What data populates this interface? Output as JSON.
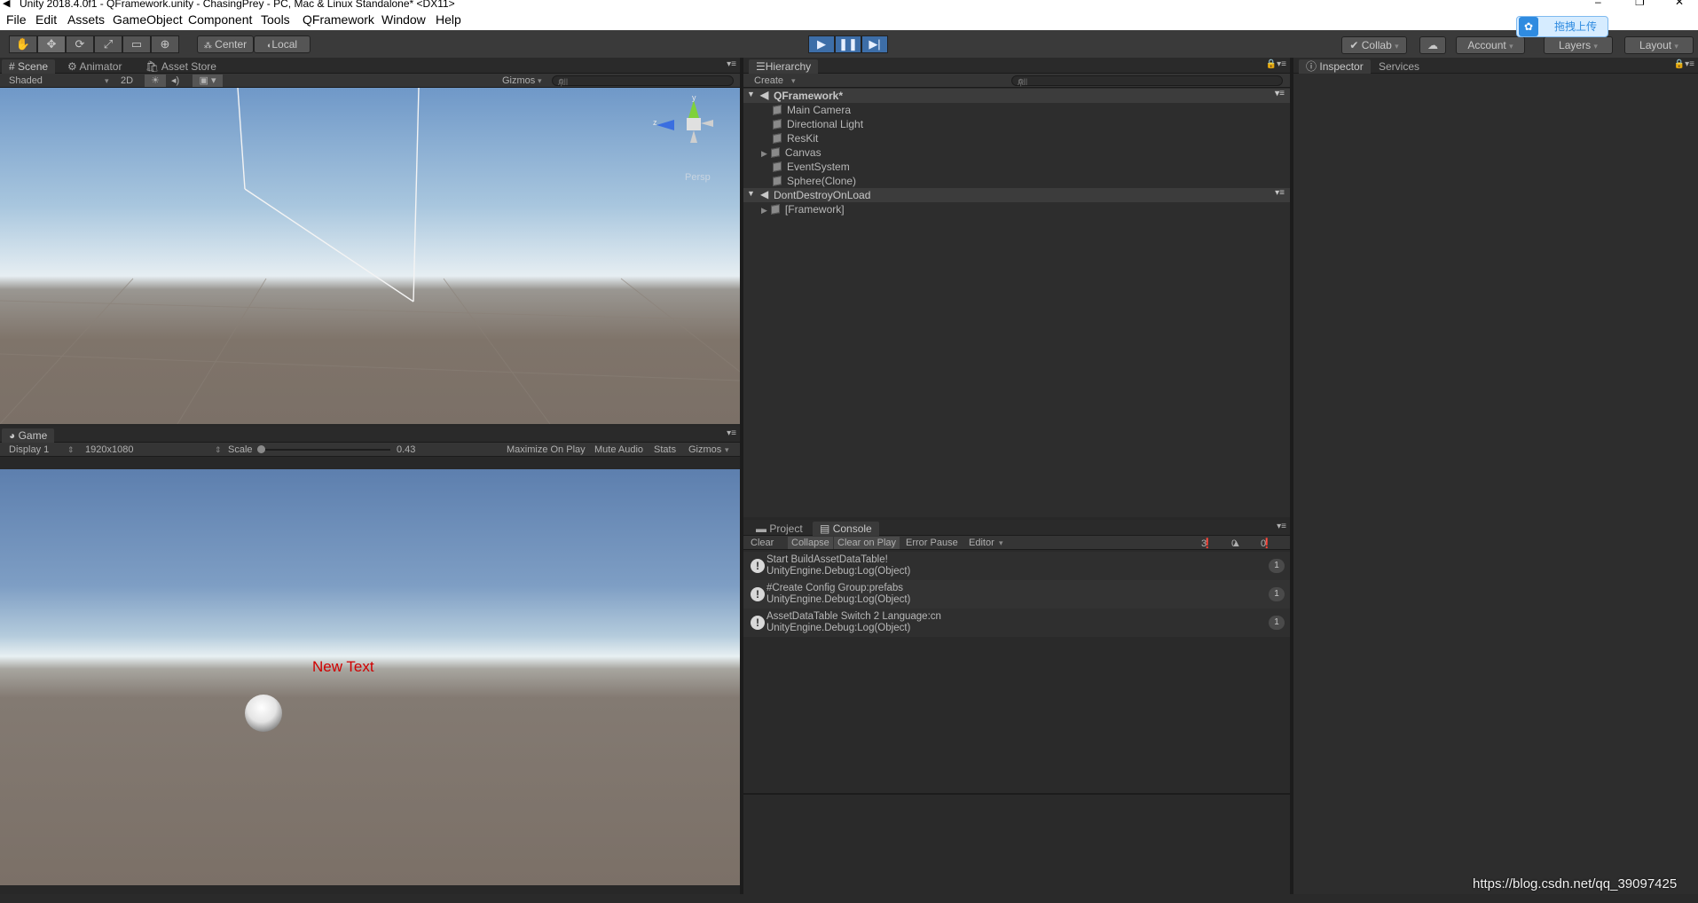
{
  "window": {
    "title": "Unity 2018.4.0f1 - QFramework.unity - ChasingPrey - PC, Mac & Linux Standalone* <DX11>",
    "min": "–",
    "max": "❐",
    "close": "✕"
  },
  "menu": [
    "File",
    "Edit",
    "Assets",
    "GameObject",
    "Component",
    "Tools",
    "QFramework",
    "Window",
    "Help"
  ],
  "toolbar": {
    "pivot": "Center",
    "space": "Local",
    "collab": "Collab",
    "account": "Account",
    "layers": "Layers",
    "layout": "Layout",
    "upload_badge": "拖拽上传"
  },
  "scene": {
    "tabs": [
      "Scene",
      "Animator",
      "Asset Store"
    ],
    "shading": "Shaded",
    "mode2d": "2D",
    "gizmos": "Gizmos",
    "search_placeholder": "All",
    "persp": "Persp",
    "axis_y": "y",
    "axis_z": "z",
    "colors": {
      "sky_top": "#6f98c8",
      "horizon": "#dde8ee",
      "ground": "#7b7067"
    }
  },
  "game": {
    "tab": "Game",
    "display": "Display 1",
    "resolution": "1920x1080",
    "scale_label": "Scale",
    "scale_value": "0.43",
    "maximize": "Maximize On Play",
    "mute": "Mute Audio",
    "stats": "Stats",
    "gizmos": "Gizmos",
    "ui_text": "New Text",
    "ui_text_color": "#d00000"
  },
  "hierarchy": {
    "tab": "Hierarchy",
    "create": "Create",
    "search_placeholder": "All",
    "scenes": [
      {
        "name": "QFramework*",
        "items": [
          {
            "label": "Main Camera",
            "expandable": false
          },
          {
            "label": "Directional Light",
            "expandable": false
          },
          {
            "label": "ResKit",
            "expandable": false
          },
          {
            "label": "Canvas",
            "expandable": true
          },
          {
            "label": "EventSystem",
            "expandable": false
          },
          {
            "label": "Sphere(Clone)",
            "expandable": false
          }
        ]
      },
      {
        "name": "DontDestroyOnLoad",
        "items": [
          {
            "label": "[Framework]",
            "expandable": true
          }
        ]
      }
    ]
  },
  "console": {
    "tabs": [
      "Project",
      "Console"
    ],
    "buttons": [
      "Clear",
      "Collapse",
      "Clear on Play",
      "Error Pause",
      "Editor"
    ],
    "counts": {
      "info": "3",
      "warn": "0",
      "error": "0"
    },
    "entries": [
      {
        "line1": "Start BuildAssetDataTable!",
        "line2": "UnityEngine.Debug:Log(Object)",
        "count": "1"
      },
      {
        "line1": "#Create Config Group:prefabs",
        "line2": "UnityEngine.Debug:Log(Object)",
        "count": "1"
      },
      {
        "line1": "AssetDataTable Switch 2 Language:cn",
        "line2": "UnityEngine.Debug:Log(Object)",
        "count": "1"
      }
    ]
  },
  "inspector": {
    "tabs": [
      "Inspector",
      "Services"
    ]
  },
  "watermark": "https://blog.csdn.net/qq_39097425"
}
